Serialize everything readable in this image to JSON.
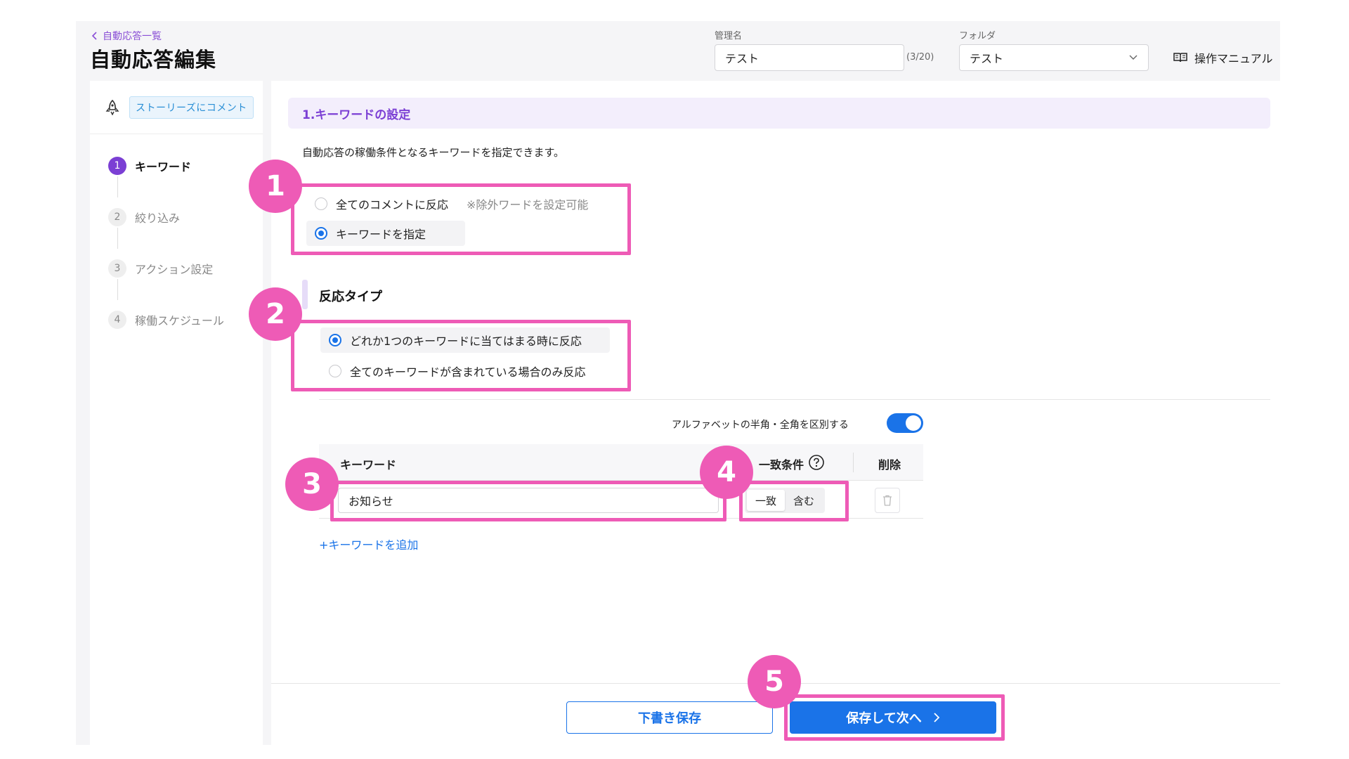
{
  "header": {
    "back_label": "自動応答一覧",
    "title": "自動応答編集",
    "name_label": "管理名",
    "name_value": "テスト",
    "name_counter": "(3/20)",
    "folder_label": "フォルダ",
    "folder_value": "テスト",
    "manual_label": "操作マニュアル"
  },
  "sidebar": {
    "trigger_badge": "ストーリーズにコメント",
    "steps": [
      {
        "num": "1",
        "label": "キーワード"
      },
      {
        "num": "2",
        "label": "絞り込み"
      },
      {
        "num": "3",
        "label": "アクション設定"
      },
      {
        "num": "4",
        "label": "稼働スケジュール"
      }
    ]
  },
  "main": {
    "section_title": "1.キーワードの設定",
    "description": "自動応答の稼働条件となるキーワードを指定できます。",
    "scope_options": [
      {
        "label": "全てのコメントに反応",
        "note": "※除外ワードを設定可能"
      },
      {
        "label": "キーワードを指定"
      }
    ],
    "reaction_title": "反応タイプ",
    "reaction_options": [
      {
        "label": "どれか1つのキーワードに当てはまる時に反応"
      },
      {
        "label": "全てのキーワードが含まれている場合のみ反応"
      }
    ],
    "toggle_label": "アルファベットの半角・全角を区別する",
    "table": {
      "col_keyword": "キーワード",
      "col_match": "一致条件",
      "col_delete": "削除",
      "rows": [
        {
          "keyword": "お知らせ",
          "match_options": [
            "一致",
            "含む"
          ]
        }
      ]
    },
    "add_keyword": "+キーワードを追加"
  },
  "footer": {
    "draft_label": "下書き保存",
    "next_label": "保存して次へ"
  },
  "annotations": [
    "1",
    "2",
    "3",
    "4",
    "5"
  ],
  "colors": {
    "accent": "#1a73e8",
    "purple": "#7b3fd4",
    "highlight": "#ee5bb6"
  }
}
